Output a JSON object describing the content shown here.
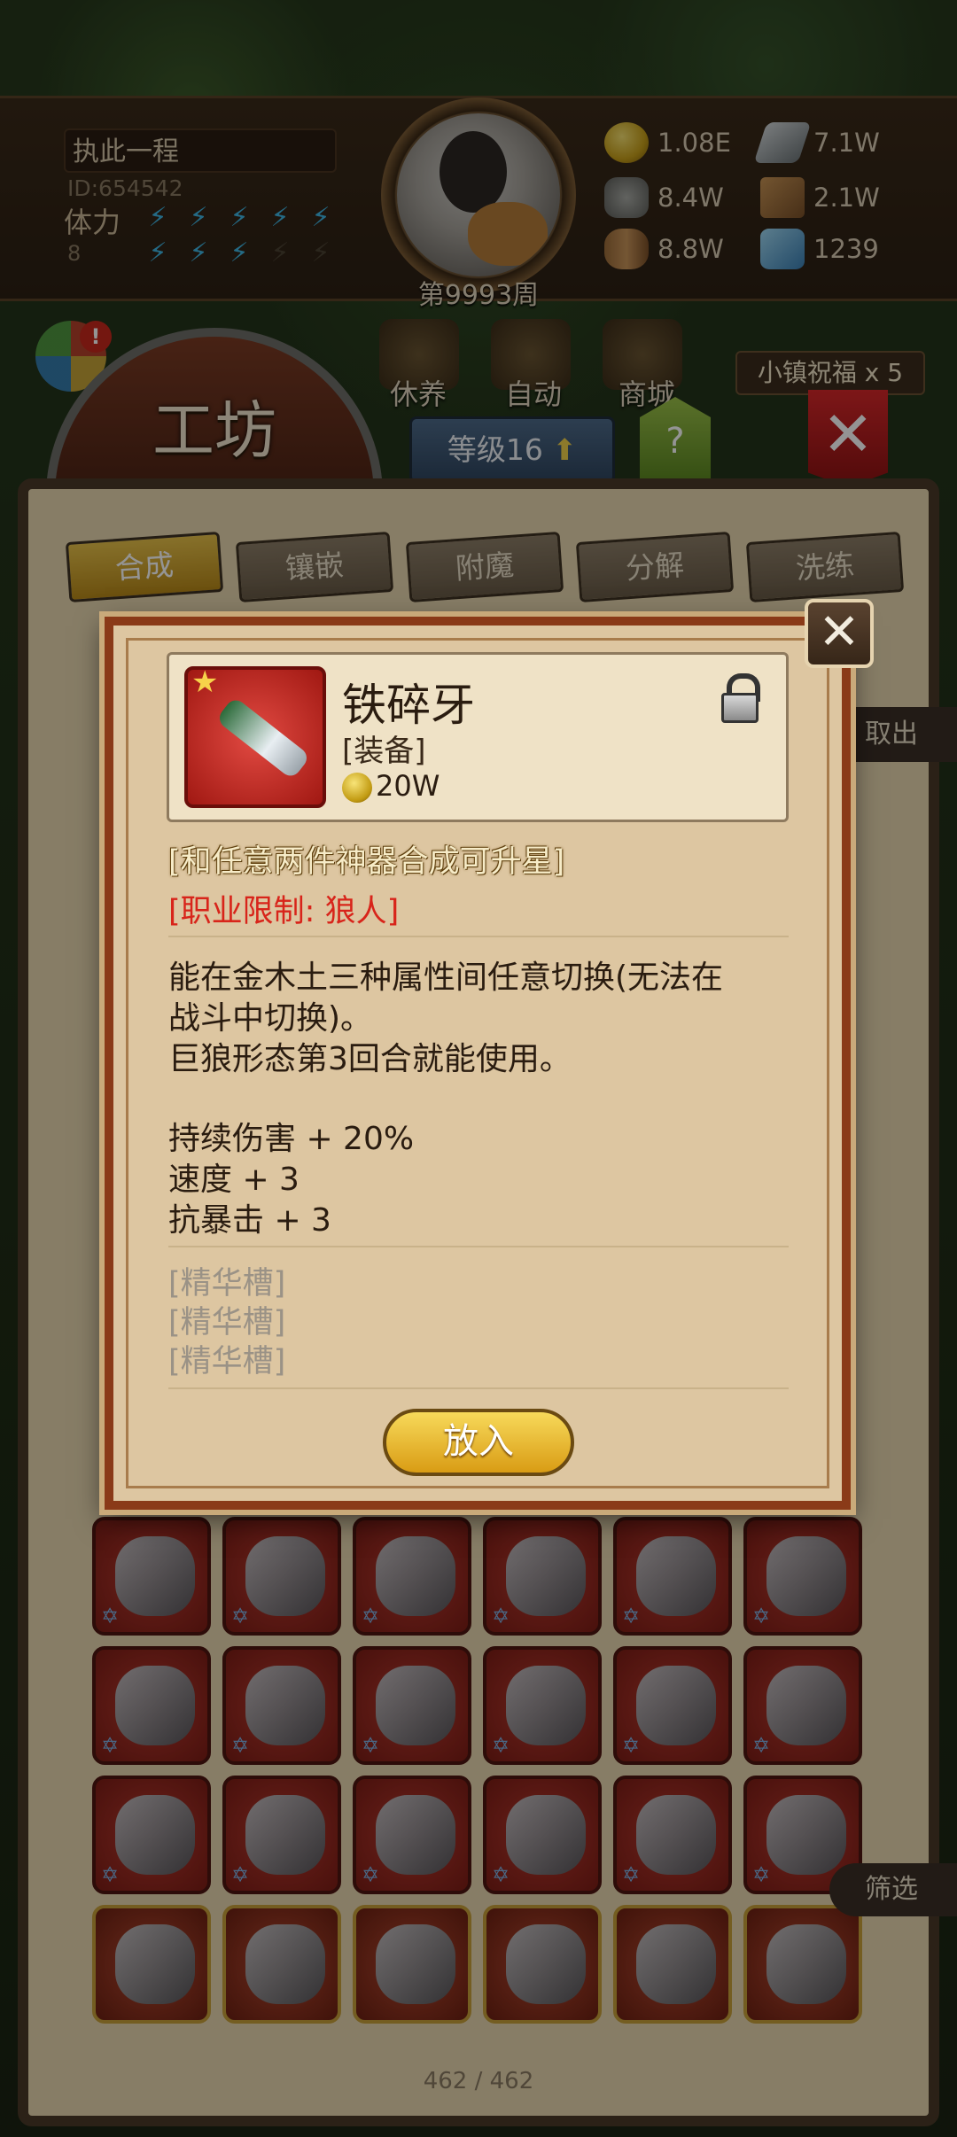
{
  "hud": {
    "player_name": "执此一程",
    "player_id": "ID:654542",
    "stamina_label": "体力",
    "stamina_value": "8",
    "stamina_filled": 8,
    "stamina_max": 10,
    "week_label": "第9993周",
    "resources": [
      {
        "icon": "gold-coin-icon",
        "value": "1.08E"
      },
      {
        "icon": "iron-ingot-icon",
        "value": "7.1W"
      },
      {
        "icon": "stone-ore-icon",
        "value": "8.4W"
      },
      {
        "icon": "leather-icon",
        "value": "2.1W"
      },
      {
        "icon": "wood-log-icon",
        "value": "8.8W"
      },
      {
        "icon": "crystal-icon",
        "value": "1239"
      }
    ]
  },
  "menu": {
    "badge": "!",
    "rest_label": "休养",
    "auto_label": "自动",
    "shop_label": "商城",
    "blessing": "小镇祝福 x 5",
    "workshop_title": "工坊",
    "level": "等级16",
    "help": "?"
  },
  "tabs": [
    {
      "label": "合成",
      "active": true
    },
    {
      "label": "镶嵌",
      "active": false
    },
    {
      "label": "附魔",
      "active": false
    },
    {
      "label": "分解",
      "active": false
    },
    {
      "label": "洗练",
      "active": false
    }
  ],
  "side": {
    "take_out": "取出",
    "filter": "筛选",
    "inventory_count": "462 / 462"
  },
  "popup": {
    "item_name": "铁碎牙",
    "item_type": "[装备]",
    "item_price": "20W",
    "upgrade_note": "[和任意两件神器合成可升星]",
    "restriction": "[职业限制: 狼人]",
    "desc_line1": "能在金木土三种属性间任意切换(无法在",
    "desc_line2": "战斗中切换)。",
    "desc_line3": "巨狼形态第3回合就能使用。",
    "stat1": "持续伤害 + 20%",
    "stat2": "速度 + 3",
    "stat3": "抗暴击 + 3",
    "slots": [
      "[精华槽]",
      "[精华槽]",
      "[精华槽]"
    ],
    "put_button": "放入"
  },
  "inventory_icons": [
    "hammer-icon",
    "scythe-icon",
    "spear-icon",
    "orb-icon",
    "sword-icon",
    "fire-orb-icon",
    "ring-icon",
    "helmet-icon",
    "axe-icon",
    "gem-ring-icon",
    "whip-icon",
    "armor-icon",
    "dagger-icon",
    "flask-icon",
    "gold-ring-icon",
    "gauntlet-icon",
    "cape-icon",
    "mask-icon",
    "pickaxe-icon",
    "pickaxe-icon",
    "crossed-swords-icon",
    "crossed-swords-icon",
    "bow-icon",
    "bow-icon"
  ]
}
